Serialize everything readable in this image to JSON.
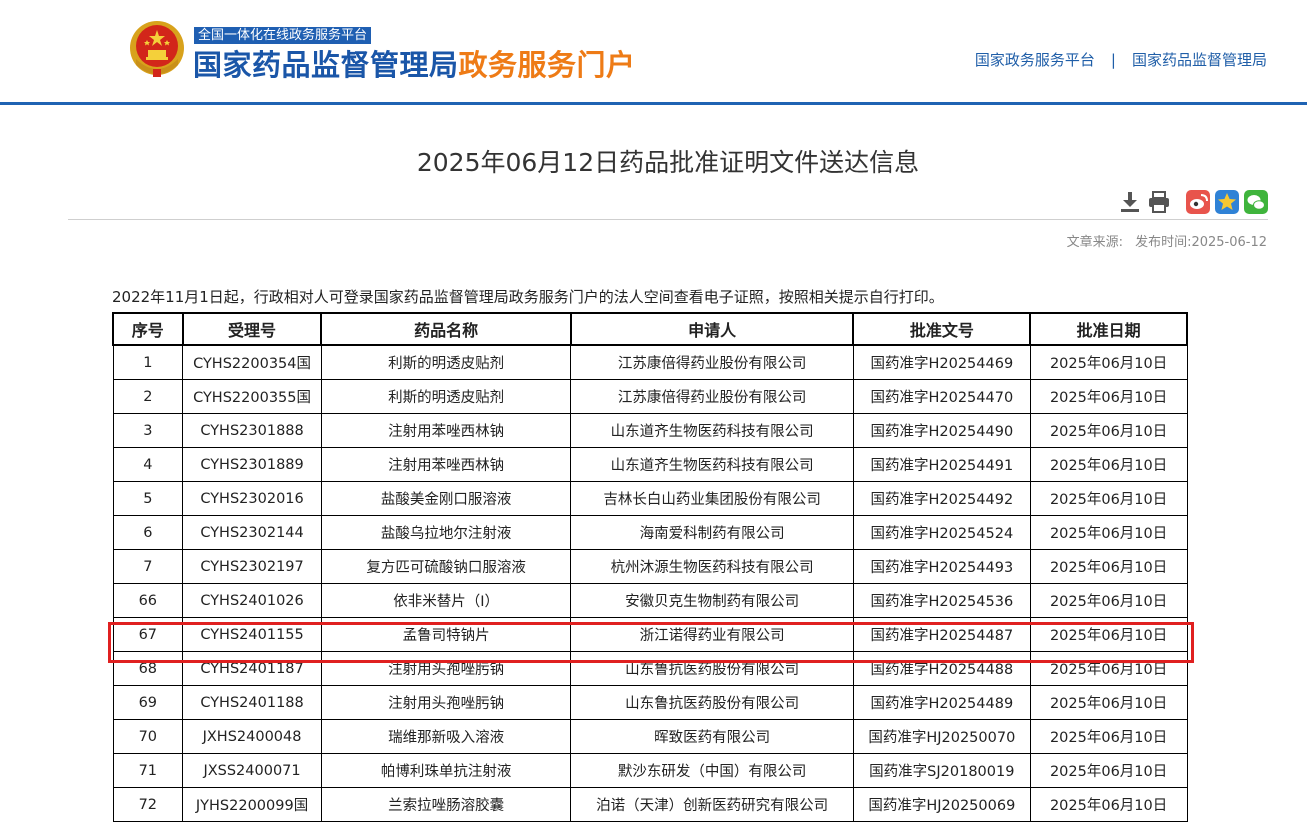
{
  "header": {
    "platform_tag": "全国一体化在线政务服务平台",
    "brand_primary": "国家药品监督管理局",
    "brand_secondary": "政务服务门户",
    "links": [
      "国家政务服务平台",
      "国家药品监督管理局"
    ],
    "link_separator": "|"
  },
  "page": {
    "title": "2025年06月12日药品批准证明文件送达信息",
    "source_label": "文章来源:",
    "publish_label": "发布时间:2025-06-12",
    "notice": "2022年11月1日起，行政相对人可登录国家药品监督管理局政务服务门户的法人空间查看电子证照，按照相关提示自行打印。"
  },
  "toolbar": {
    "icons": [
      "download-icon",
      "print-icon",
      "weibo-icon",
      "favorite-icon",
      "wechat-icon"
    ]
  },
  "table": {
    "headers": [
      "序号",
      "受理号",
      "药品名称",
      "申请人",
      "批准文号",
      "批准日期"
    ],
    "rows": [
      [
        "1",
        "CYHS2200354国",
        "利斯的明透皮贴剂",
        "江苏康倍得药业股份有限公司",
        "国药准字H20254469",
        "2025年06月10日"
      ],
      [
        "2",
        "CYHS2200355国",
        "利斯的明透皮贴剂",
        "江苏康倍得药业股份有限公司",
        "国药准字H20254470",
        "2025年06月10日"
      ],
      [
        "3",
        "CYHS2301888",
        "注射用苯唑西林钠",
        "山东道齐生物医药科技有限公司",
        "国药准字H20254490",
        "2025年06月10日"
      ],
      [
        "4",
        "CYHS2301889",
        "注射用苯唑西林钠",
        "山东道齐生物医药科技有限公司",
        "国药准字H20254491",
        "2025年06月10日"
      ],
      [
        "5",
        "CYHS2302016",
        "盐酸美金刚口服溶液",
        "吉林长白山药业集团股份有限公司",
        "国药准字H20254492",
        "2025年06月10日"
      ],
      [
        "6",
        "CYHS2302144",
        "盐酸乌拉地尔注射液",
        "海南爱科制药有限公司",
        "国药准字H20254524",
        "2025年06月10日"
      ],
      [
        "7",
        "CYHS2302197",
        "复方匹可硫酸钠口服溶液",
        "杭州沐源生物医药科技有限公司",
        "国药准字H20254493",
        "2025年06月10日"
      ],
      [
        "66",
        "CYHS2401026",
        "依非米替片（I）",
        "安徽贝克生物制药有限公司",
        "国药准字H20254536",
        "2025年06月10日"
      ],
      [
        "67",
        "CYHS2401155",
        "孟鲁司特钠片",
        "浙江诺得药业有限公司",
        "国药准字H20254487",
        "2025年06月10日"
      ],
      [
        "68",
        "CYHS2401187",
        "注射用头孢唑肟钠",
        "山东鲁抗医药股份有限公司",
        "国药准字H20254488",
        "2025年06月10日"
      ],
      [
        "69",
        "CYHS2401188",
        "注射用头孢唑肟钠",
        "山东鲁抗医药股份有限公司",
        "国药准字H20254489",
        "2025年06月10日"
      ],
      [
        "70",
        "JXHS2400048",
        "瑞维那新吸入溶液",
        "晖致医药有限公司",
        "国药准字HJ20250070",
        "2025年06月10日"
      ],
      [
        "71",
        "JXSS2400071",
        "帕博利珠单抗注射液",
        "默沙东研发（中国）有限公司",
        "国药准字SJ20180019",
        "2025年06月10日"
      ],
      [
        "72",
        "JYHS2200099国",
        "兰索拉唑肠溶胶囊",
        "泊诺（天津）创新医药研究有限公司",
        "国药准字HJ20250069",
        "2025年06月10日"
      ]
    ],
    "highlighted_row_index": 8,
    "highlight_color": "#e02020"
  },
  "colors": {
    "brand_blue": "#1a56a8",
    "brand_orange": "#ee7b16",
    "header_rule": "#1f63b3"
  }
}
